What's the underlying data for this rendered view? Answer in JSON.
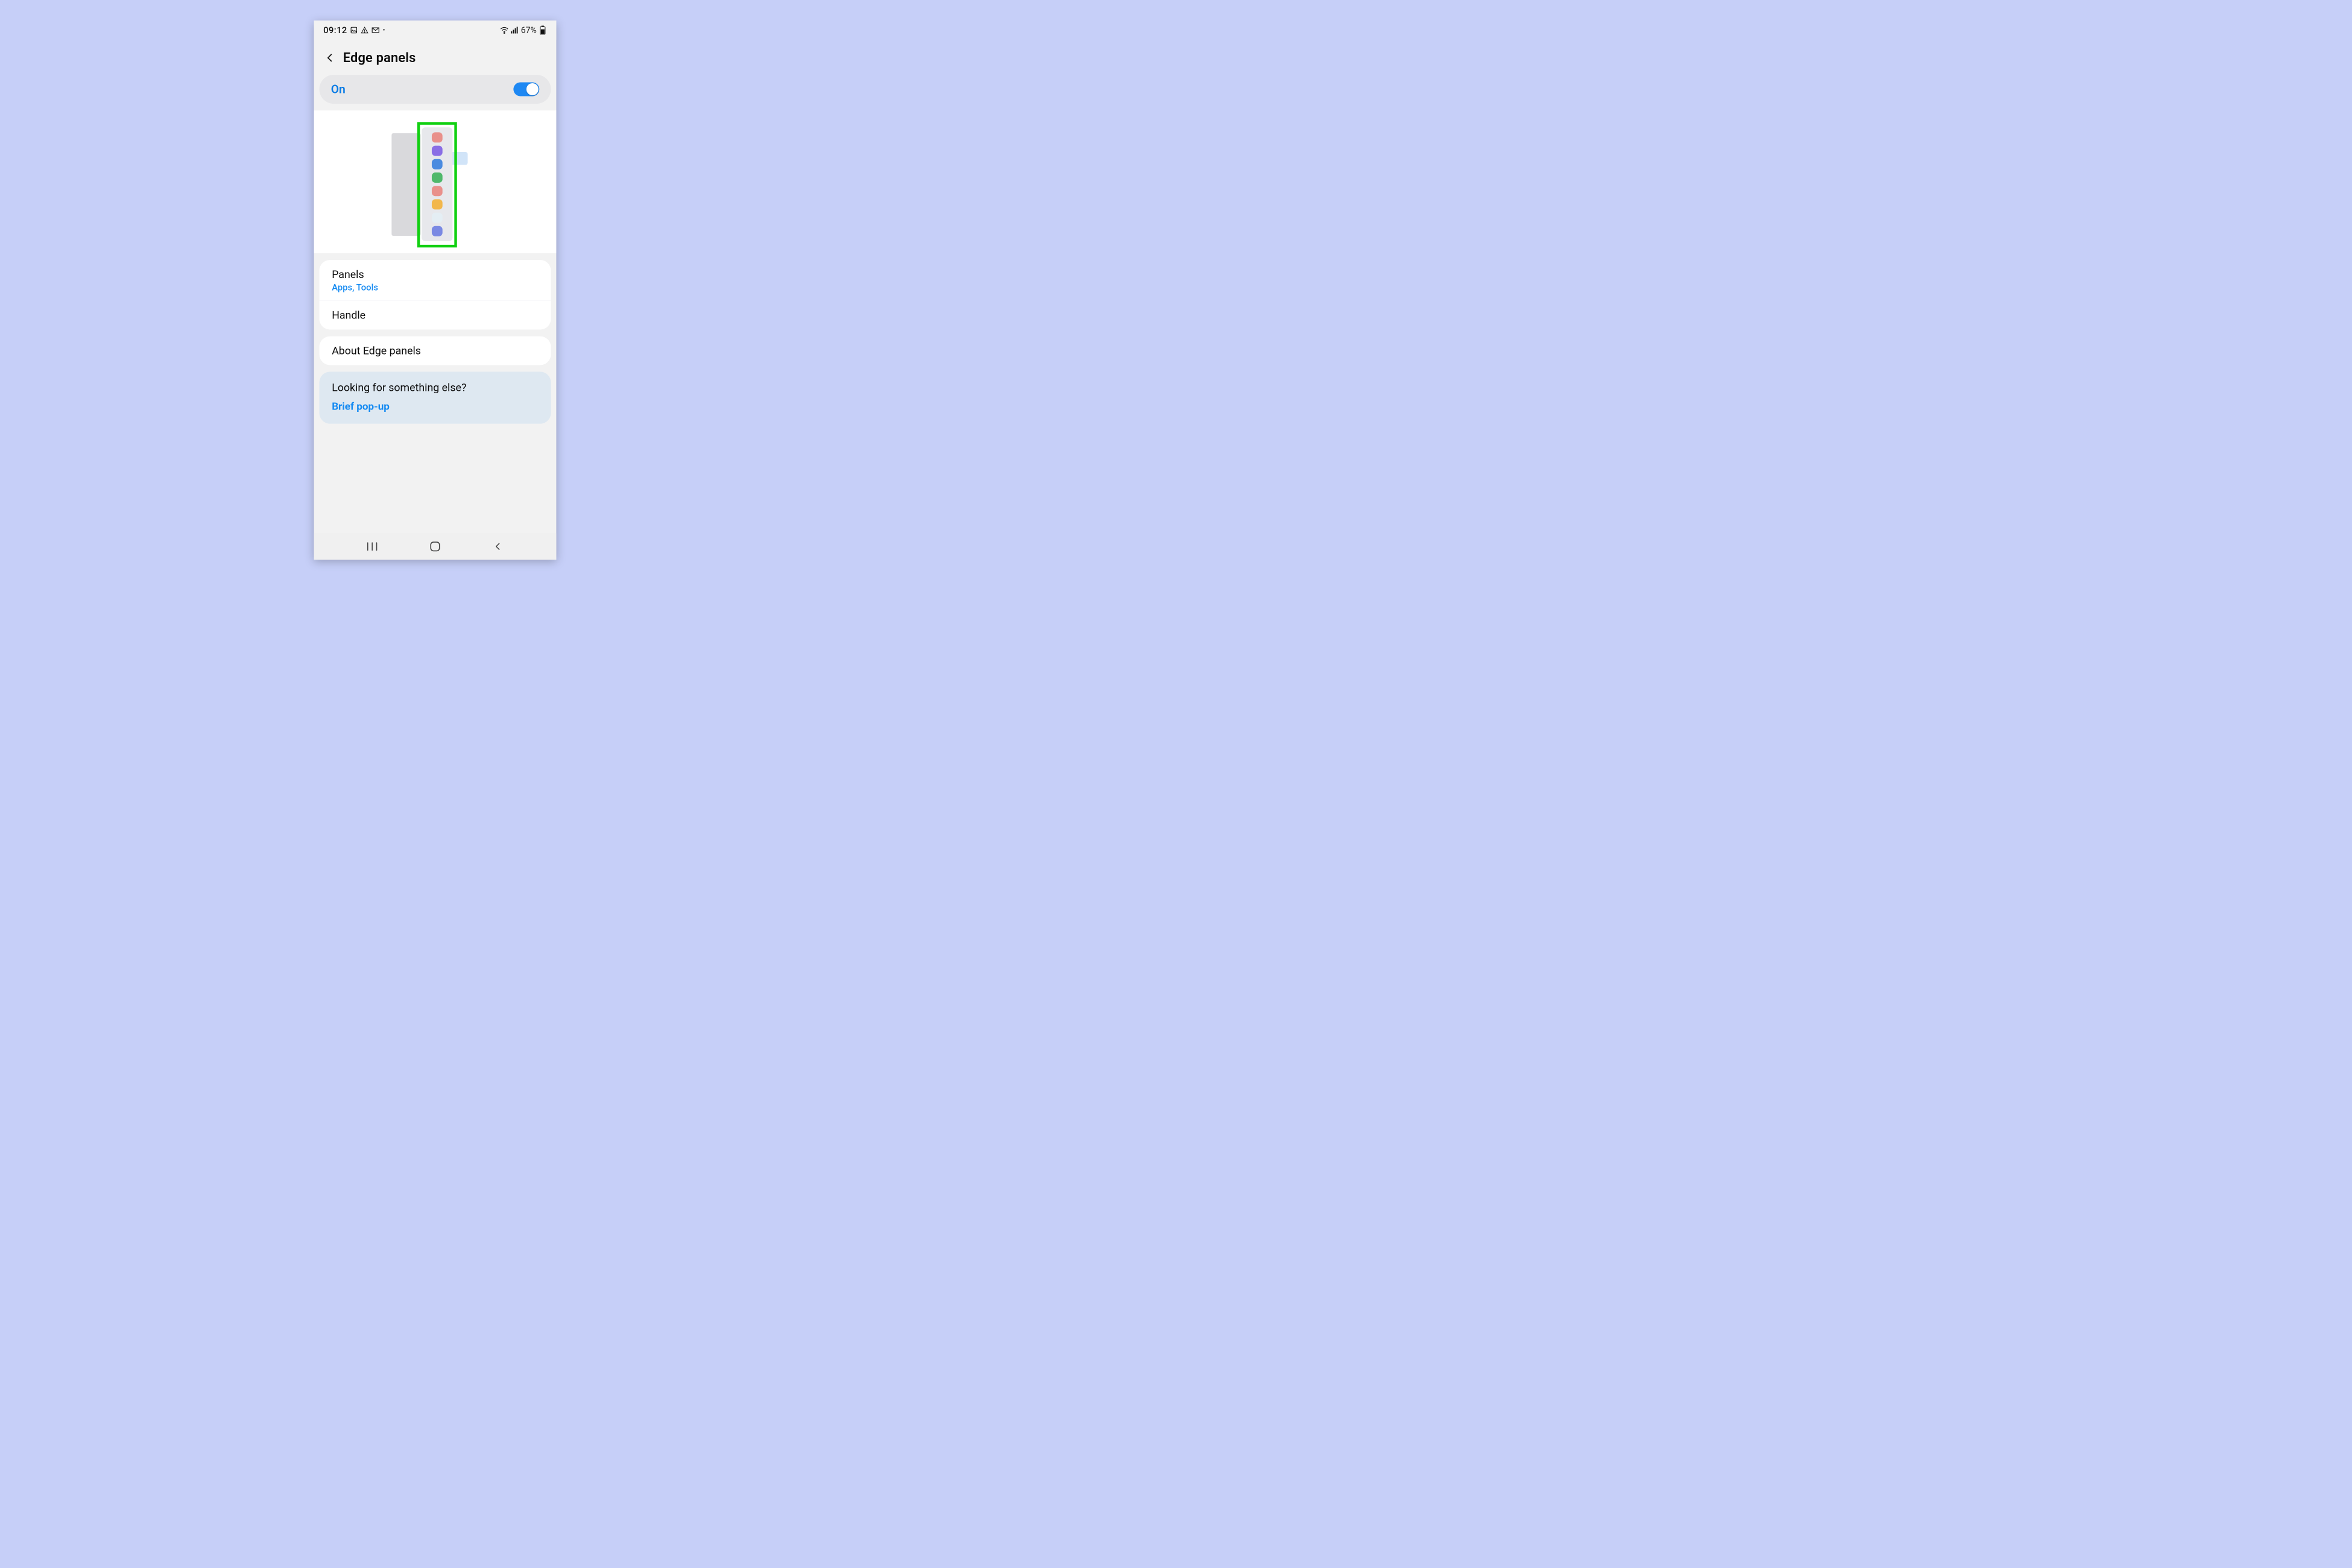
{
  "statusbar": {
    "time": "09:12",
    "battery_text": "67%",
    "icons_left": [
      "picture-icon",
      "warning-icon",
      "gmail-icon",
      "dot-icon"
    ],
    "icons_right": [
      "wifi-icon",
      "signal-icon"
    ]
  },
  "header": {
    "title": "Edge panels"
  },
  "toggle": {
    "label": "On",
    "state": "on"
  },
  "preview": {
    "highlight": {
      "name": "edge-panel-highlight"
    },
    "panel_dots": [
      "#e9908b",
      "#8a6ee5",
      "#4a8be0",
      "#4fb86b",
      "#e9908b",
      "#f2b74c",
      "#e4eef4",
      "#7a89e3"
    ]
  },
  "rows": {
    "panels": {
      "title": "Panels",
      "subtitle": "Apps, Tools"
    },
    "handle": {
      "title": "Handle"
    },
    "about": {
      "title": "About Edge panels"
    }
  },
  "looking": {
    "title": "Looking for something else?",
    "link": "Brief pop-up"
  }
}
